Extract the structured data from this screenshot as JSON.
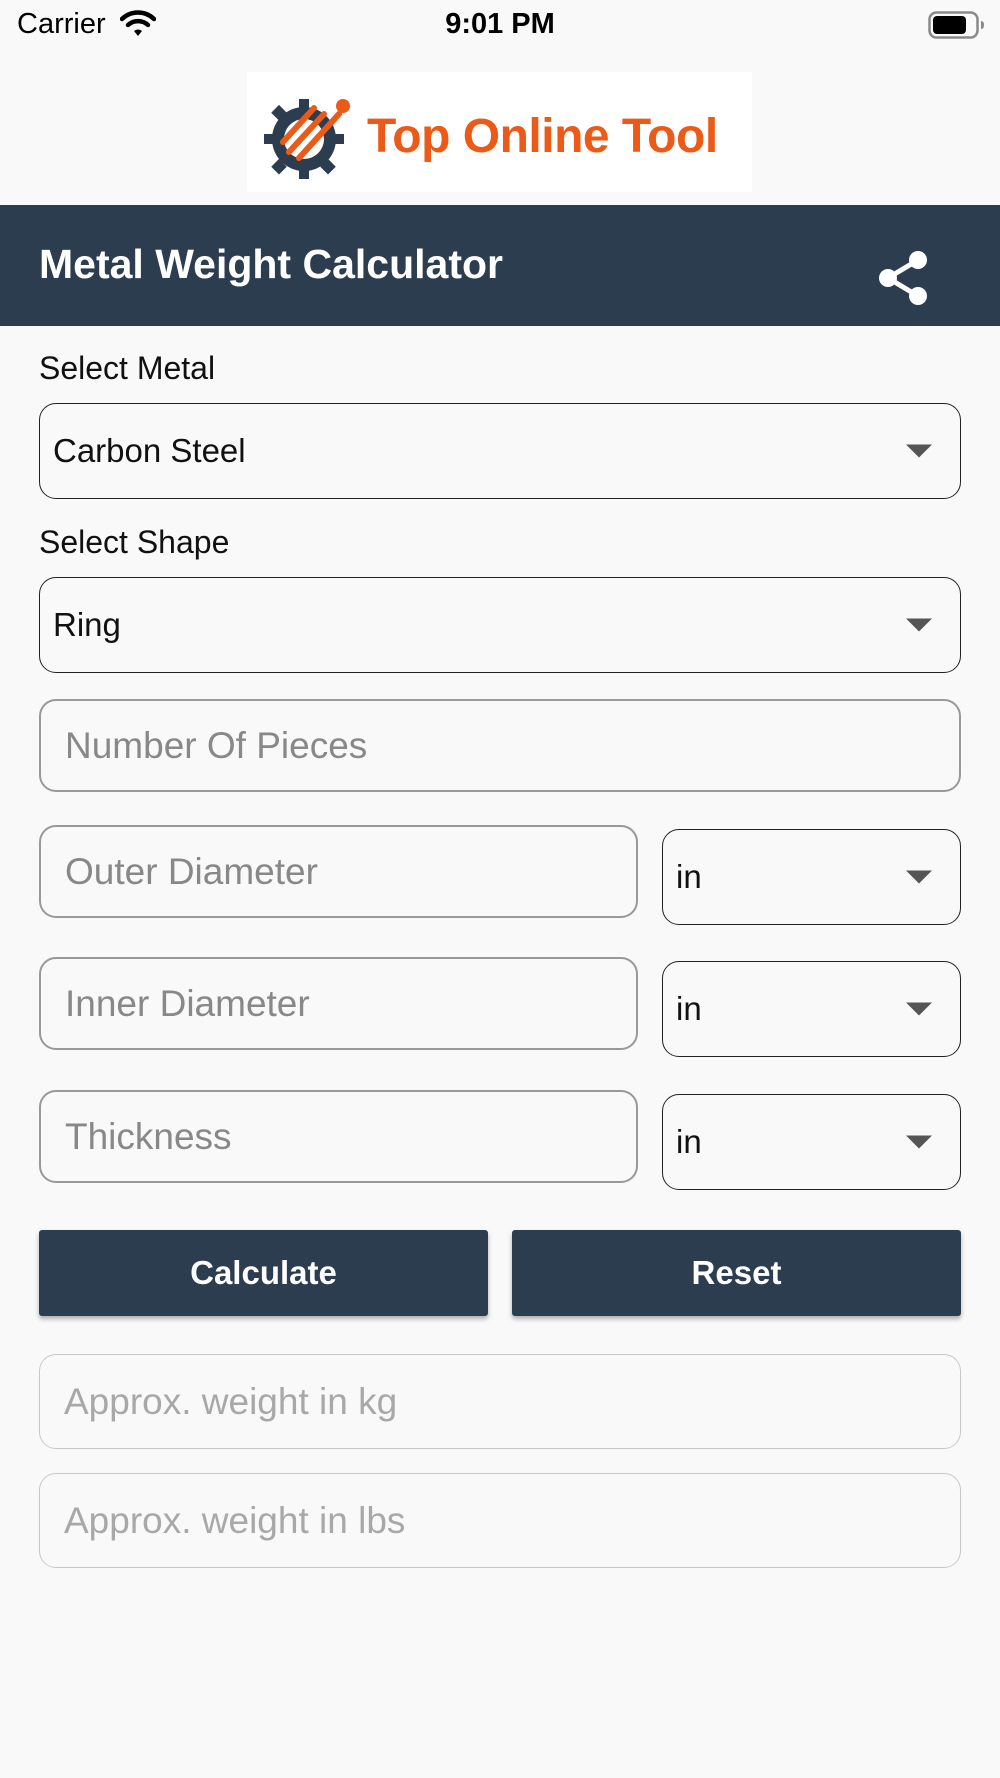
{
  "status_bar": {
    "carrier": "Carrier",
    "time": "9:01 PM"
  },
  "logo": {
    "text": "Top Online Tool",
    "brand_color": "#ec5a17",
    "icon": "gear-logo-icon"
  },
  "header": {
    "title": "Metal Weight Calculator",
    "background": "#2c3d50",
    "share_icon": "share-icon"
  },
  "metal": {
    "label": "Select Metal",
    "selected": "Carbon Steel"
  },
  "shape": {
    "label": "Select Shape",
    "selected": "Ring"
  },
  "fields": {
    "pieces_placeholder": "Number Of Pieces",
    "outer_placeholder": "Outer Diameter",
    "outer_unit": "in",
    "inner_placeholder": "Inner Diameter",
    "inner_unit": "in",
    "thickness_placeholder": "Thickness",
    "thickness_unit": "in"
  },
  "buttons": {
    "calculate": "Calculate",
    "reset": "Reset"
  },
  "results": {
    "kg_placeholder": "Approx. weight in kg",
    "lbs_placeholder": "Approx. weight in lbs"
  }
}
